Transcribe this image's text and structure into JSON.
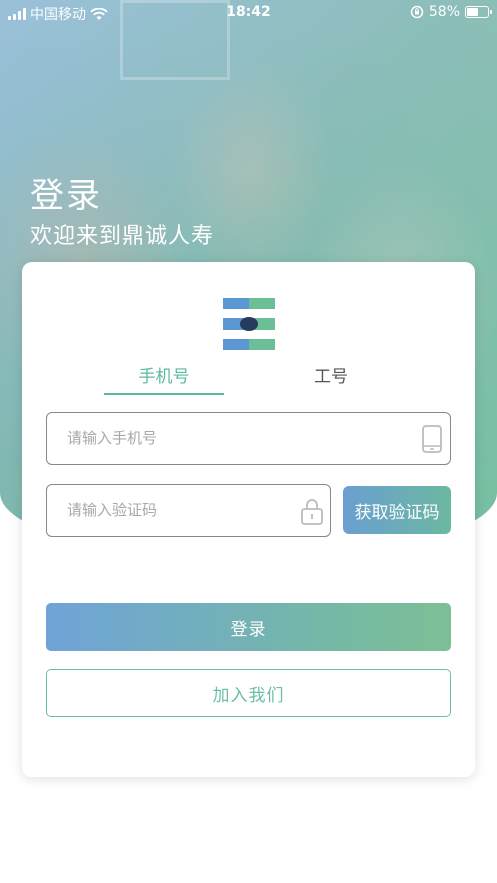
{
  "status_bar": {
    "carrier": "中国移动",
    "time": "18:42",
    "battery_percent_label": "58%",
    "battery_level": 0.58,
    "icons": [
      "signal-icon",
      "wifi-icon",
      "orientation-lock-icon",
      "battery-icon"
    ]
  },
  "hero": {
    "title": "登录",
    "subtitle": "欢迎来到鼎诚人寿"
  },
  "tabs": [
    {
      "label": "手机号",
      "active": true
    },
    {
      "label": "工号",
      "active": false
    }
  ],
  "phone_field": {
    "value": "",
    "placeholder": "请输入手机号",
    "icon": "phone-icon"
  },
  "code_field": {
    "value": "",
    "placeholder": "请输入验证码",
    "icon": "lock-icon"
  },
  "buttons": {
    "get_code": "获取验证码",
    "login": "登录",
    "join": "加入我们"
  },
  "colors": {
    "accent_green": "#5db8a3",
    "accent_blue": "#6b9fd2",
    "logo_blue": "#5b97d3",
    "logo_green": "#6bbf96",
    "logo_dark": "#263b5e"
  }
}
